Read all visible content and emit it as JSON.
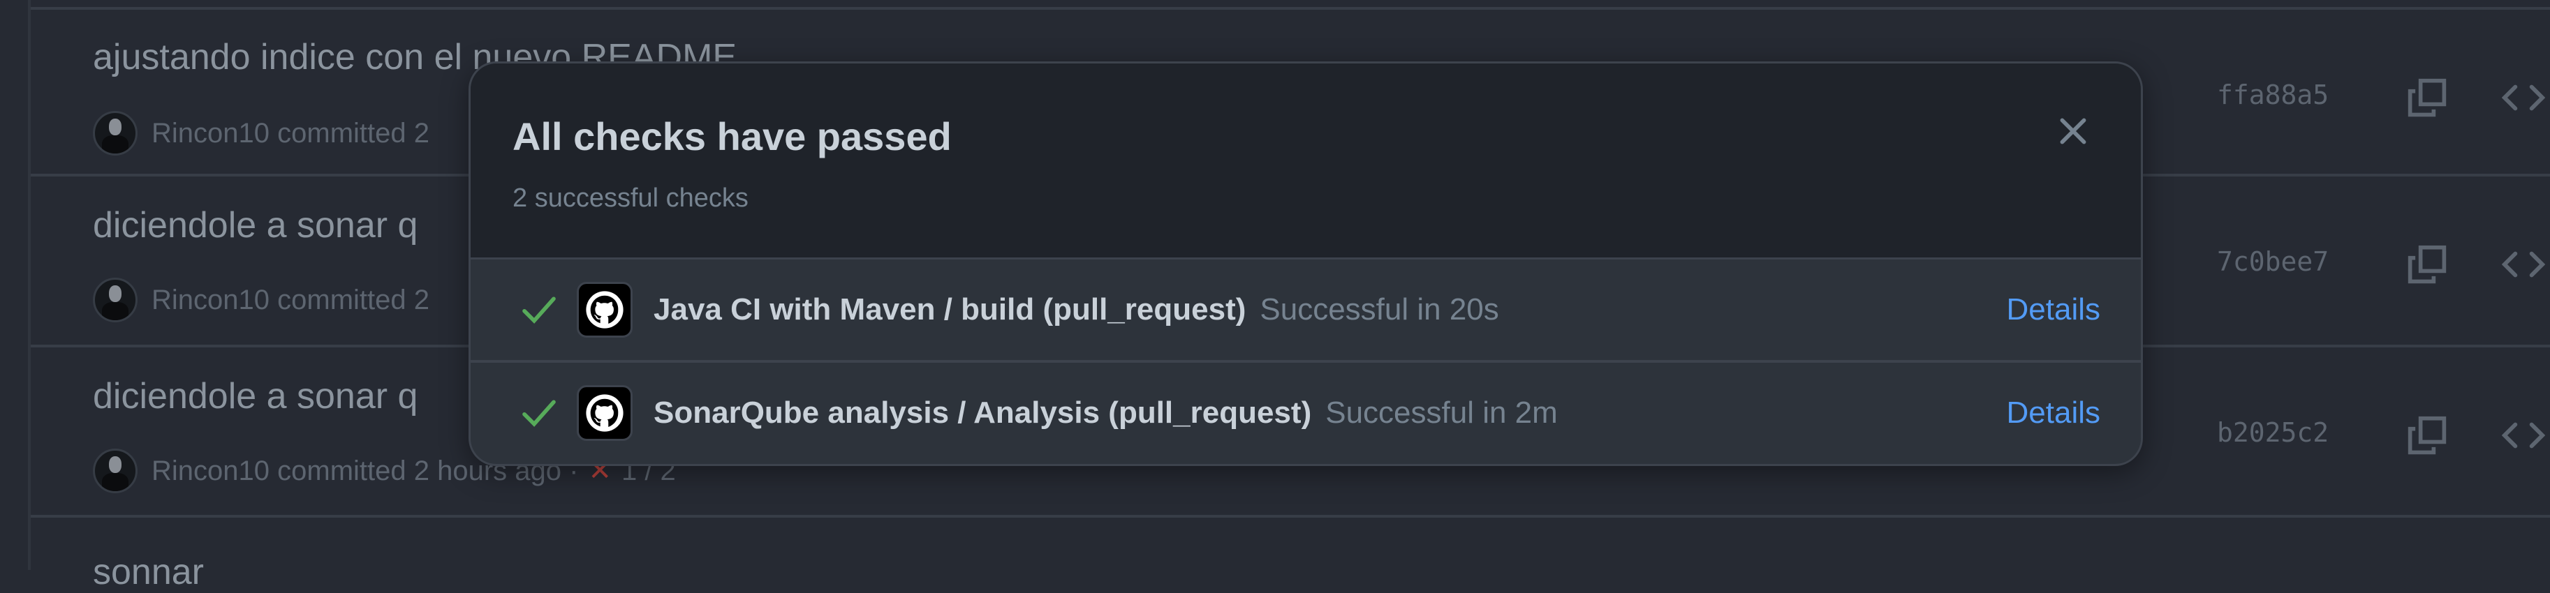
{
  "commits": [
    {
      "title": "ajustando indice con el nuevo README",
      "author": "Rincon10",
      "committed": "committed 2",
      "hash": "ffa88a5"
    },
    {
      "title": "diciendole a sonar q",
      "author": "Rincon10",
      "committed": "committed 2",
      "hash": "7c0bee7"
    },
    {
      "title": "diciendole a sonar q",
      "author": "Rincon10",
      "committed": "committed 2 hours ago ·",
      "status_icon": "x-icon",
      "status_count": "1 / 2",
      "hash": "b2025c2"
    },
    {
      "title": "sonnar"
    }
  ],
  "popover": {
    "title": "All checks have passed",
    "subtitle": "2 successful checks",
    "checks": [
      {
        "name": "Java CI with Maven / build (pull_request)",
        "duration": "Successful in 20s",
        "link": "Details"
      },
      {
        "name": "SonarQube analysis / Analysis (pull_request)",
        "duration": "Successful in 2m",
        "link": "Details"
      }
    ]
  },
  "colors": {
    "success": "#57ab5a",
    "link": "#539bf5",
    "fail": "#b4403b"
  }
}
